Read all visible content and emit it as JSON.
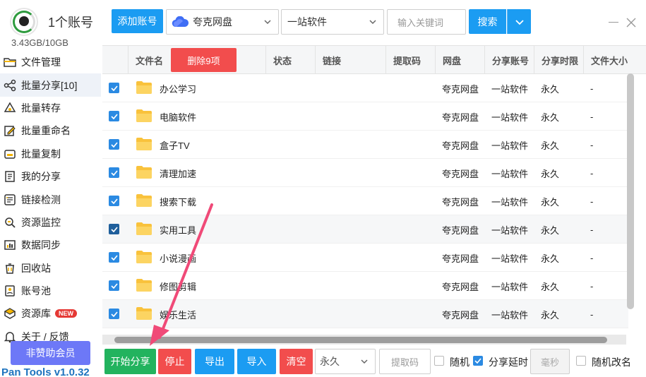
{
  "sidebar": {
    "account_title": "1个账号",
    "storage": "3.43GB/10GB",
    "items": [
      {
        "label": "文件管理",
        "icon": "folder-icon"
      },
      {
        "label": "批量分享[10]",
        "icon": "share-icon"
      },
      {
        "label": "批量转存",
        "icon": "transfer-icon"
      },
      {
        "label": "批量重命名",
        "icon": "rename-icon"
      },
      {
        "label": "批量复制",
        "icon": "copy-icon"
      },
      {
        "label": "我的分享",
        "icon": "my-share-icon"
      },
      {
        "label": "链接检测",
        "icon": "link-check-icon"
      },
      {
        "label": "资源监控",
        "icon": "monitor-icon"
      },
      {
        "label": "数据同步",
        "icon": "sync-icon"
      },
      {
        "label": "回收站",
        "icon": "trash-icon"
      },
      {
        "label": "账号池",
        "icon": "account-pool-icon"
      },
      {
        "label": "资源库",
        "icon": "library-icon",
        "badge": "NEW"
      },
      {
        "label": "关于 / 反馈",
        "icon": "bell-icon"
      }
    ],
    "sponsor": "非赞助会员",
    "version": "Pan Tools v1.0.32"
  },
  "toolbar": {
    "add_account": "添加账号",
    "drive_select": "夸克网盘",
    "account_select": "一站软件",
    "search_placeholder": "输入关键词",
    "search": "搜索"
  },
  "table": {
    "delete_button": "删除9项",
    "columns": [
      "文件名",
      "状态",
      "链接",
      "提取码",
      "网盘",
      "分享账号",
      "分享时限",
      "文件大小"
    ],
    "rows": [
      {
        "name": "办公学习",
        "drive": "夸克网盘",
        "account": "一站软件",
        "limit": "永久",
        "size": "-"
      },
      {
        "name": "电脑软件",
        "drive": "夸克网盘",
        "account": "一站软件",
        "limit": "永久",
        "size": "-"
      },
      {
        "name": "盒子TV",
        "drive": "夸克网盘",
        "account": "一站软件",
        "limit": "永久",
        "size": "-"
      },
      {
        "name": "清理加速",
        "drive": "夸克网盘",
        "account": "一站软件",
        "limit": "永久",
        "size": "-"
      },
      {
        "name": "搜索下载",
        "drive": "夸克网盘",
        "account": "一站软件",
        "limit": "永久",
        "size": "-"
      },
      {
        "name": "实用工具",
        "drive": "夸克网盘",
        "account": "一站软件",
        "limit": "永久",
        "size": "-"
      },
      {
        "name": "小说漫画",
        "drive": "夸克网盘",
        "account": "一站软件",
        "limit": "永久",
        "size": "-"
      },
      {
        "name": "修图剪辑",
        "drive": "夸克网盘",
        "account": "一站软件",
        "limit": "永久",
        "size": "-"
      },
      {
        "name": "娱乐生活",
        "drive": "夸克网盘",
        "account": "一站软件",
        "limit": "永久",
        "size": "-"
      }
    ]
  },
  "bottom": {
    "start_share": "开始分享",
    "stop": "停止",
    "export": "导出",
    "import": "导入",
    "clear": "清空",
    "duration_select": "永久",
    "code_placeholder": "提取码",
    "random_label": "随机",
    "delay_label": "分享延时",
    "ms_placeholder": "毫秒",
    "random_rename_label": "随机改名"
  },
  "colors": {
    "primary": "#1b9cf2",
    "danger": "#f24d4d",
    "success": "#22b35e",
    "sponsor": "#6d78f7",
    "annotation": "#f04a78"
  }
}
